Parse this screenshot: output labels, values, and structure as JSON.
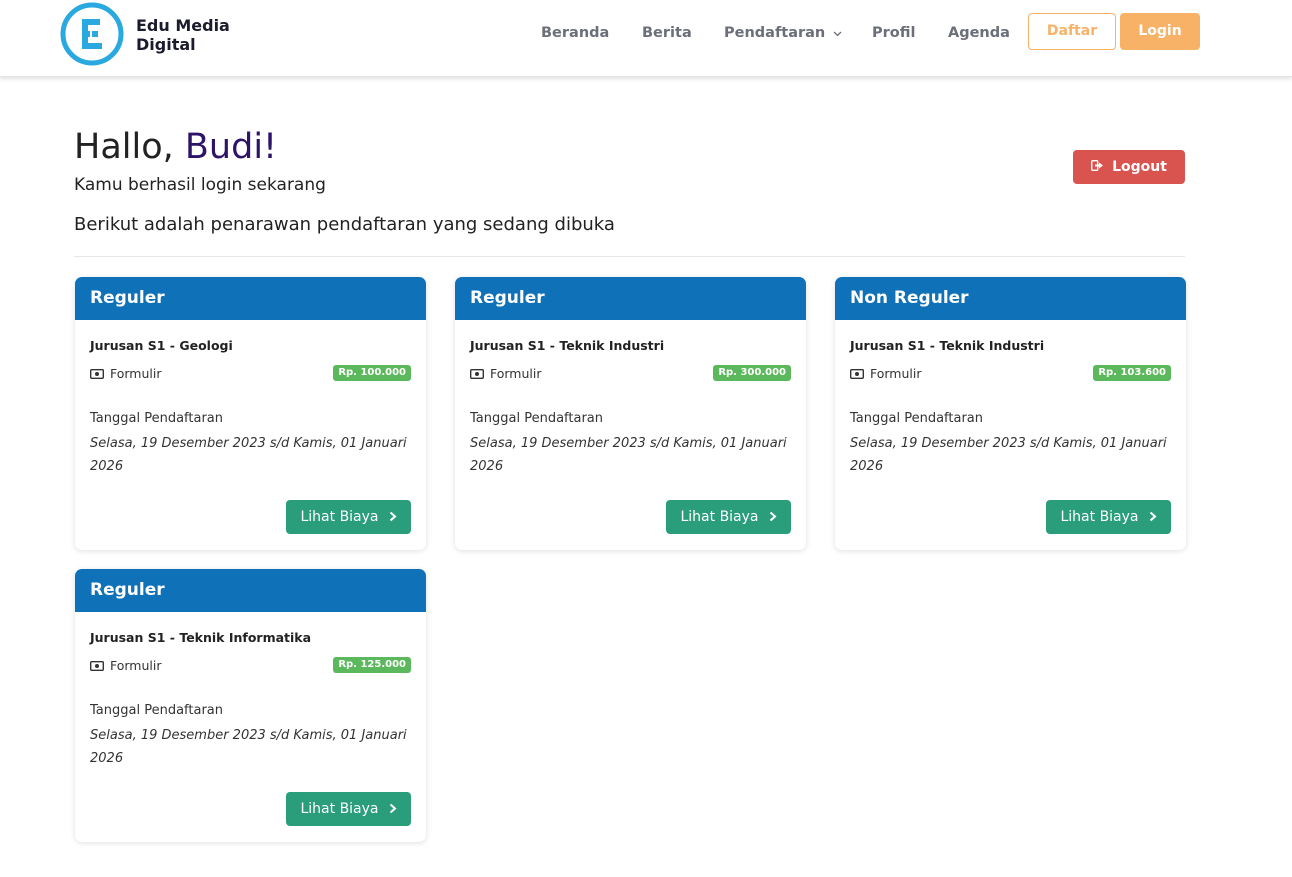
{
  "brand": {
    "name": "Edu Media Digital",
    "logo_icon": "edu-media-logo-icon"
  },
  "nav": {
    "items": [
      {
        "label": "Beranda"
      },
      {
        "label": "Berita"
      },
      {
        "label": "Pendaftaran",
        "icon": "chevron-down-icon"
      },
      {
        "label": "Profil"
      },
      {
        "label": "Agenda"
      }
    ],
    "daftar_label": "Daftar",
    "login_label": "Login"
  },
  "greeting": {
    "hello": "Hallo,",
    "name": "Budi!",
    "subtitle": "Kamu berhasil login sekarang",
    "intro": "Berikut adalah penarawan pendaftaran yang sedang dibuka"
  },
  "logout": {
    "label": "Logout",
    "icon": "sign-out-icon"
  },
  "colors": {
    "primary": "#0f71b8",
    "accent": "#f7b267",
    "danger": "#d9534f",
    "success": "#2a9d7a",
    "badge": "#5cb85c",
    "name": "#2d1468"
  },
  "cards": [
    {
      "title": "Reguler",
      "jurusan": "Jurusan S1 - Geologi",
      "form_label": "Formulir",
      "price": "Rp. 100.000",
      "tanggal_label": "Tanggal Pendaftaran",
      "tanggal": "Selasa, 19 Desember 2023 s/d Kamis, 01 Januari 2026",
      "button": "Lihat Biaya"
    },
    {
      "title": "Reguler",
      "jurusan": "Jurusan S1 - Teknik Industri",
      "form_label": "Formulir",
      "price": "Rp. 300.000",
      "tanggal_label": "Tanggal Pendaftaran",
      "tanggal": "Selasa, 19 Desember 2023 s/d Kamis, 01 Januari 2026",
      "button": "Lihat Biaya"
    },
    {
      "title": "Non Reguler",
      "jurusan": "Jurusan S1 - Teknik Industri",
      "form_label": "Formulir",
      "price": "Rp. 103.600",
      "tanggal_label": "Tanggal Pendaftaran",
      "tanggal": "Selasa, 19 Desember 2023 s/d Kamis, 01 Januari 2026",
      "button": "Lihat Biaya"
    },
    {
      "title": "Reguler",
      "jurusan": "Jurusan S1 - Teknik Informatika",
      "form_label": "Formulir",
      "price": "Rp. 125.000",
      "tanggal_label": "Tanggal Pendaftaran",
      "tanggal": "Selasa, 19 Desember 2023 s/d Kamis, 01 Januari 2026",
      "button": "Lihat Biaya"
    }
  ]
}
